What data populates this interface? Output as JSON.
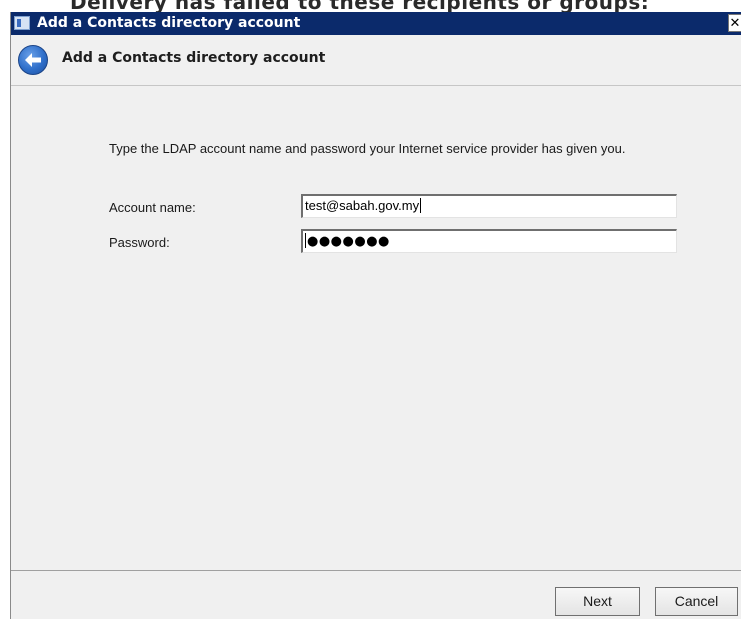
{
  "background": {
    "partial_text": "Delivery has failed to these recipients or groups:"
  },
  "window": {
    "title": "Add a Contacts directory account",
    "close_glyph": "✕"
  },
  "header": {
    "title": "Add a Contacts directory account"
  },
  "content": {
    "instruction": "Type the LDAP account name and password your Internet service provider has given you.",
    "account_name_label": "Account name:",
    "account_name_value": "test@sabah.gov.my",
    "password_label": "Password:",
    "password_masked": "●●●●●●●"
  },
  "footer": {
    "next_label": "Next",
    "cancel_label": "Cancel"
  },
  "colors": {
    "titlebar": "#0b2a6b",
    "dialog_bg": "#f0f0f0",
    "back_button": "#2f6fca"
  },
  "icons": {
    "title_icon": "address-book-icon",
    "back": "back-arrow-icon",
    "close": "close-icon"
  }
}
